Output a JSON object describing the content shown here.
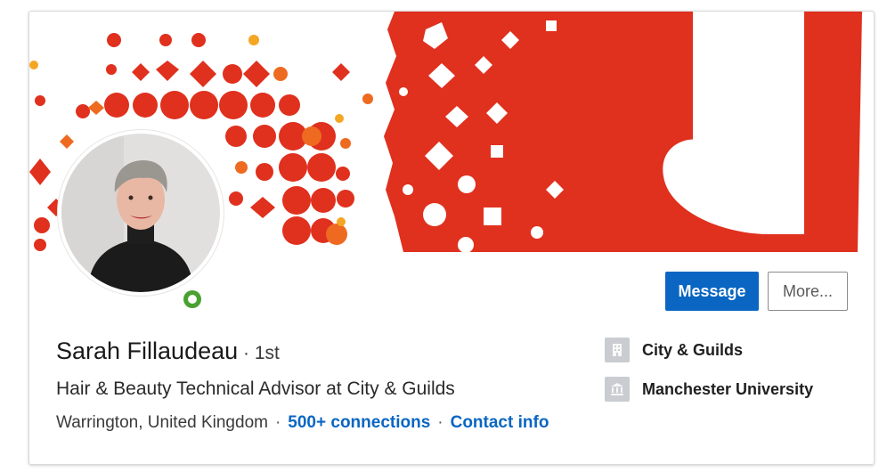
{
  "profile": {
    "name": "Sarah Fillaudeau",
    "degree_separator": " · ",
    "degree": "1st",
    "headline": "Hair & Beauty Technical Advisor at City & Guilds",
    "location": "Warrington, United Kingdom",
    "connections": "500+ connections",
    "contact_info": "Contact info",
    "separator": "·",
    "presence_status": "online"
  },
  "actions": {
    "message_label": "Message",
    "more_label": "More..."
  },
  "affiliations": [
    {
      "label": "City & Guilds",
      "icon": "company-icon"
    },
    {
      "label": "Manchester University",
      "icon": "school-icon"
    }
  ],
  "colors": {
    "banner_red": "#e0301e",
    "banner_orange": "#ee6a20",
    "link_blue": "#0a66c2",
    "presence_green": "#48a130"
  }
}
